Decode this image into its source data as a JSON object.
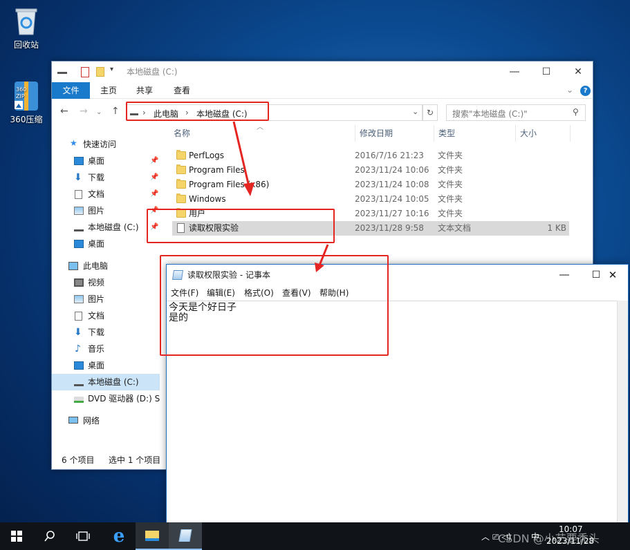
{
  "desktop": {
    "icons": [
      {
        "label": "回收站",
        "icon": "recycle-bin-icon"
      },
      {
        "label": "360压缩",
        "icon": "archive-zip-icon"
      }
    ]
  },
  "explorer": {
    "title": "本地磁盘 (C:)",
    "ribbon_tabs": [
      "文件",
      "主页",
      "共享",
      "查看"
    ],
    "breadcrumb": [
      "此电脑",
      "本地磁盘 (C:)"
    ],
    "search_placeholder": "搜索\"本地磁盘 (C:)\"",
    "columns": [
      "名称",
      "修改日期",
      "类型",
      "大小"
    ],
    "files": [
      {
        "name": "PerfLogs",
        "date": "2016/7/16 21:23",
        "type": "文件夹",
        "size": "",
        "kind": "folder"
      },
      {
        "name": "Program Files",
        "date": "2023/11/24 10:06",
        "type": "文件夹",
        "size": "",
        "kind": "folder"
      },
      {
        "name": "Program Files (x86)",
        "date": "2023/11/24 10:08",
        "type": "文件夹",
        "size": "",
        "kind": "folder"
      },
      {
        "name": "Windows",
        "date": "2023/11/24 10:05",
        "type": "文件夹",
        "size": "",
        "kind": "folder"
      },
      {
        "name": "用户",
        "date": "2023/11/27 10:16",
        "type": "文件夹",
        "size": "",
        "kind": "folder"
      },
      {
        "name": "读取权限实验",
        "date": "2023/11/28 9:58",
        "type": "文本文档",
        "size": "1 KB",
        "kind": "text",
        "selected": true
      }
    ],
    "sidebar": {
      "quick_access": "快速访问",
      "quick_items": [
        "桌面",
        "下载",
        "文档",
        "图片",
        "本地磁盘 (C:)",
        "桌面"
      ],
      "this_pc": "此电脑",
      "pc_items": [
        "视频",
        "图片",
        "文档",
        "下载",
        "音乐",
        "桌面",
        "本地磁盘 (C:)",
        "DVD 驱动器 (D:) SS"
      ],
      "network": "网络"
    },
    "status": {
      "count": "6 个项目",
      "selected": "选中 1 个项目"
    }
  },
  "notepad": {
    "title": "读取权限实验 - 记事本",
    "menu": [
      "文件(F)",
      "编辑(E)",
      "格式(O)",
      "查看(V)",
      "帮助(H)"
    ],
    "content": "今天是个好日子\n是的"
  },
  "taskbar": {
    "time": "10:07",
    "date": "2023/11/28",
    "ime": "中",
    "watermark": "CSDN @小艺要秃头"
  },
  "colors": {
    "annotation": "#e52521",
    "accent": "#1979ca",
    "taskbar": "#101418"
  }
}
